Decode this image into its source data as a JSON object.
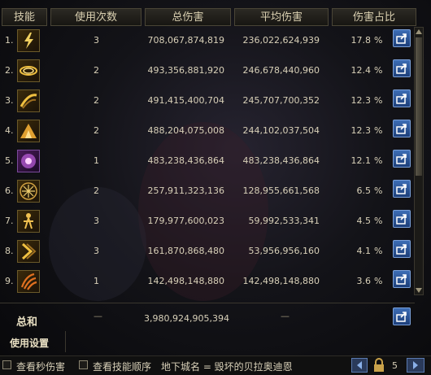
{
  "headers": {
    "skill": "技能",
    "use_count": "使用次数",
    "total_damage": "总伤害",
    "avg_damage": "平均伤害",
    "damage_share": "伤害占比"
  },
  "rows": [
    {
      "index": "1.",
      "icon": "lightning-icon",
      "count": "3",
      "total": "708,067,874,819",
      "avg": "236,022,624,939",
      "pct": "17.8",
      "pct_unit": "%"
    },
    {
      "index": "2.",
      "icon": "vortex-icon",
      "count": "2",
      "total": "493,356,881,920",
      "avg": "246,678,440,960",
      "pct": "12.4",
      "pct_unit": "%"
    },
    {
      "index": "3.",
      "icon": "slash-icon",
      "count": "2",
      "total": "491,415,400,704",
      "avg": "245,707,700,352",
      "pct": "12.3",
      "pct_unit": "%"
    },
    {
      "index": "4.",
      "icon": "eruption-icon",
      "count": "2",
      "total": "488,204,075,008",
      "avg": "244,102,037,504",
      "pct": "12.3",
      "pct_unit": "%"
    },
    {
      "index": "5.",
      "icon": "burst-icon",
      "count": "1",
      "total": "483,238,436,864",
      "avg": "483,238,436,864",
      "pct": "12.1",
      "pct_unit": "%"
    },
    {
      "index": "6.",
      "icon": "vitruvian-icon",
      "count": "2",
      "total": "257,911,323,136",
      "avg": "128,955,661,568",
      "pct": "6.5",
      "pct_unit": "%"
    },
    {
      "index": "7.",
      "icon": "warrior-icon",
      "count": "3",
      "total": "179,977,600,023",
      "avg": "59,992,533,341",
      "pct": "4.5",
      "pct_unit": "%"
    },
    {
      "index": "8.",
      "icon": "chevron-strike-icon",
      "count": "3",
      "total": "161,870,868,480",
      "avg": "53,956,956,160",
      "pct": "4.1",
      "pct_unit": "%"
    },
    {
      "index": "9.",
      "icon": "claw-icon",
      "count": "1",
      "total": "142,498,148,880",
      "avg": "142,498,148,880",
      "pct": "3.6",
      "pct_unit": "%"
    }
  ],
  "total_row": {
    "label": "总和",
    "count": "—",
    "total": "3,980,924,905,394",
    "avg": "—"
  },
  "settings_label": "使用设置",
  "bottom_bar": {
    "checkbox1_label": "查看秒伤害",
    "checkbox2_label": "查看技能顺序",
    "dungeon_text": "地下城名 = 毁坏的贝拉奥迪恩",
    "page_number": "5"
  },
  "colors": {
    "text": "#d8d0b8",
    "header_bg": "#2c2a24",
    "share_button": "#3d6db5"
  }
}
